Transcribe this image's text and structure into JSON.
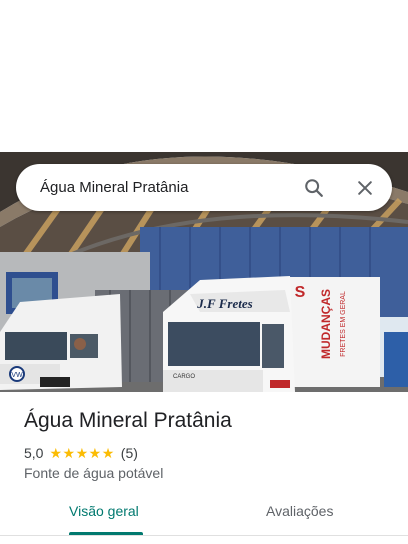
{
  "search": {
    "query": "Água Mineral Pratânia",
    "search_icon": "search-icon",
    "close_icon": "close-icon"
  },
  "photo": {
    "truck_left_brand": "VW",
    "truck_right_text": "J.F Fretes",
    "truck_right_brand": "CARGO",
    "trailer_text": "MUDANÇAS",
    "trailer_subtext": "FRETES EM GERAL",
    "trailer_side_letters": "S"
  },
  "place": {
    "title": "Água Mineral Pratânia",
    "rating": "5,0",
    "stars": 5,
    "review_count": "(5)",
    "category": "Fonte de água potável"
  },
  "tabs": [
    {
      "label": "Visão geral",
      "active": true
    },
    {
      "label": "Avaliações",
      "active": false
    }
  ],
  "colors": {
    "accent": "#01796f",
    "star": "#fbbc04"
  }
}
